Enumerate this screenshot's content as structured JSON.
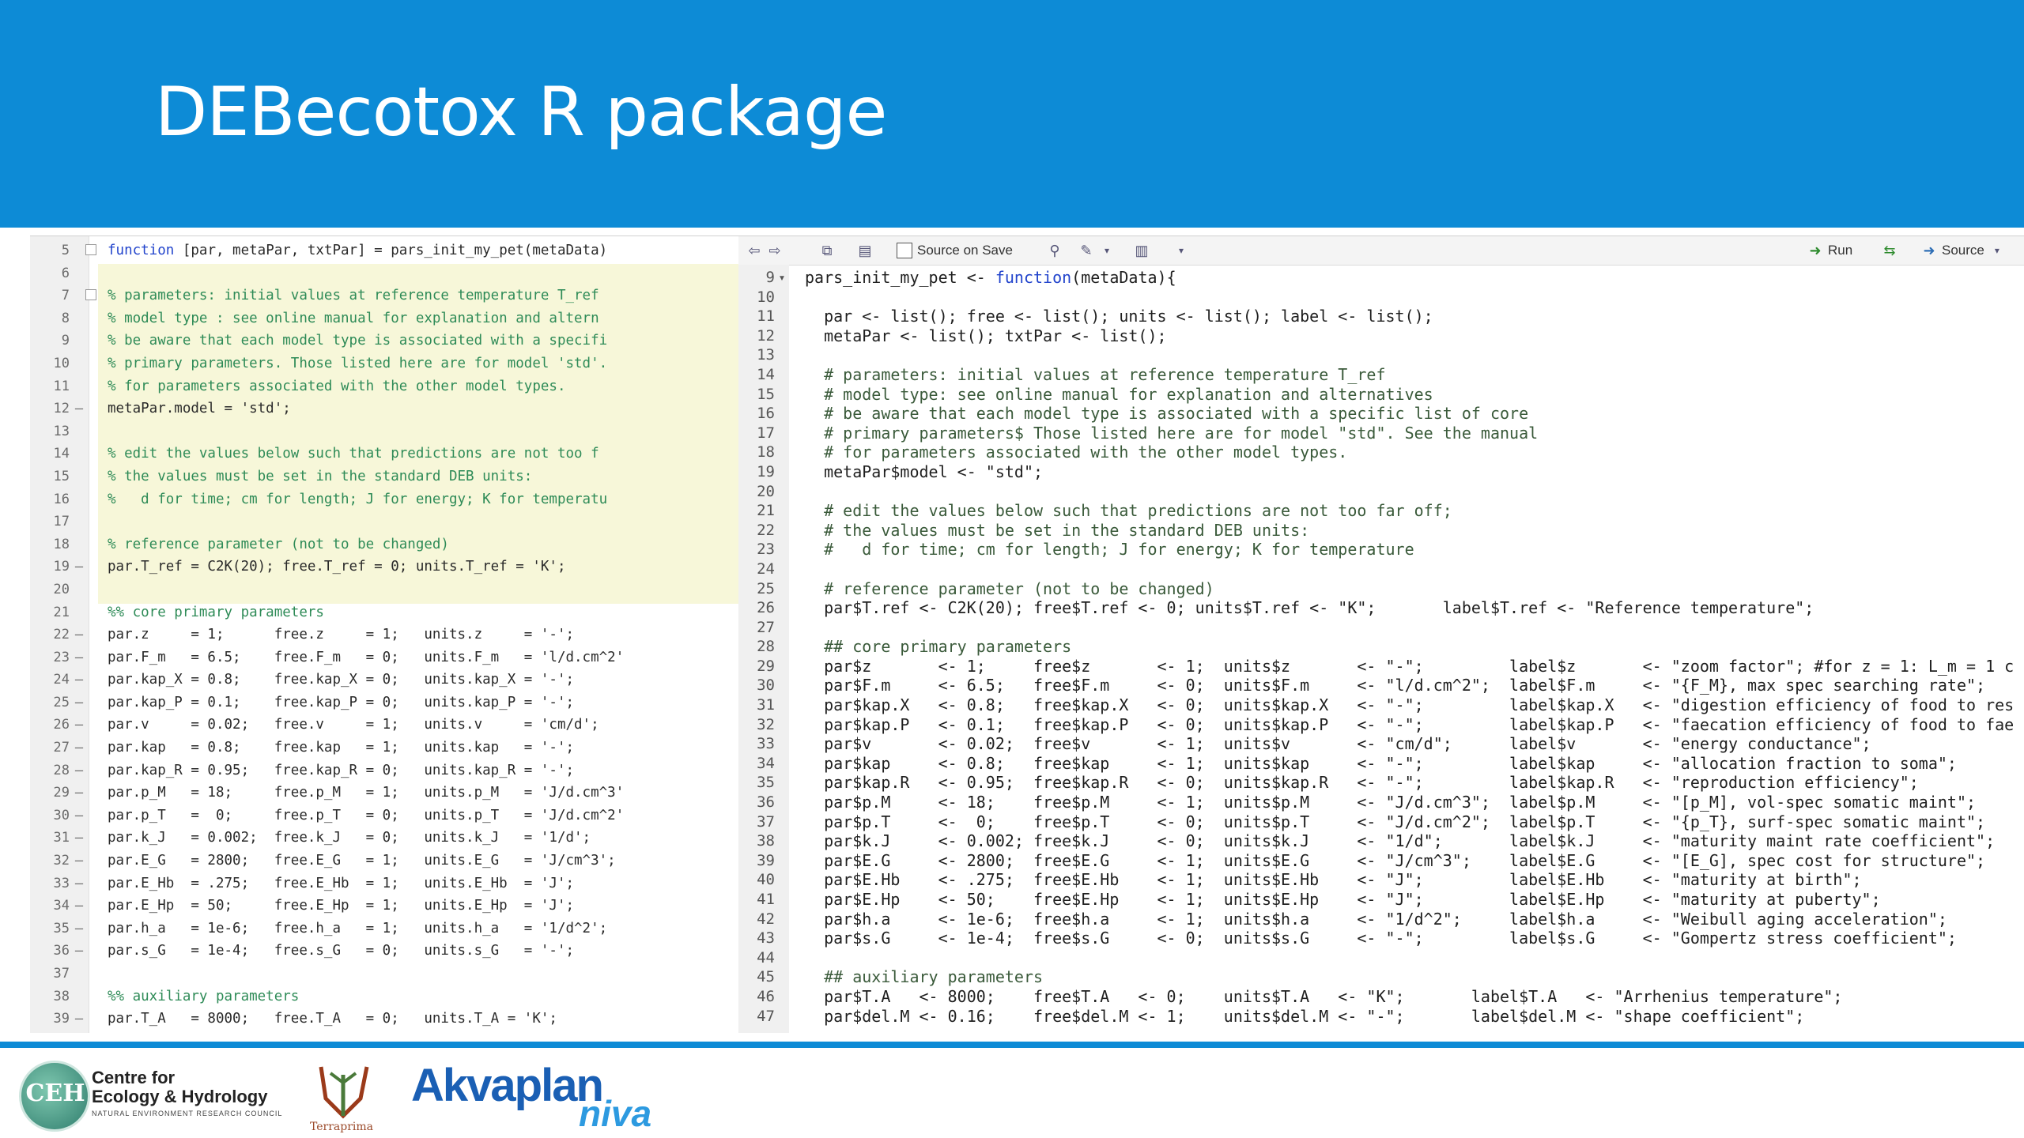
{
  "slide": {
    "title": "DEBecotox R package"
  },
  "toolbar": {
    "source_on_save": "Source on Save",
    "run": "Run",
    "source": "Source"
  },
  "left_editor": {
    "lines": [
      {
        "n": "5",
        "m": "",
        "t": "function [par, metaPar, txtPar] = pars_init_my_pet(metaData)",
        "c": false
      },
      {
        "n": "6",
        "m": "",
        "t": "",
        "c": false
      },
      {
        "n": "7",
        "m": "",
        "t": "% parameters: initial values at reference temperature T_ref",
        "c": true
      },
      {
        "n": "8",
        "m": "",
        "t": "% model type : see online manual for explanation and altern",
        "c": true
      },
      {
        "n": "9",
        "m": "",
        "t": "% be aware that each model type is associated with a specifi",
        "c": true
      },
      {
        "n": "10",
        "m": "",
        "t": "% primary parameters. Those listed here are for model 'std'.",
        "c": true
      },
      {
        "n": "11",
        "m": "",
        "t": "% for parameters associated with the other model types.",
        "c": true
      },
      {
        "n": "12",
        "m": "–",
        "t": "metaPar.model = 'std';",
        "c": false
      },
      {
        "n": "13",
        "m": "",
        "t": "",
        "c": false
      },
      {
        "n": "14",
        "m": "",
        "t": "% edit the values below such that predictions are not too f",
        "c": true
      },
      {
        "n": "15",
        "m": "",
        "t": "% the values must be set in the standard DEB units:",
        "c": true
      },
      {
        "n": "16",
        "m": "",
        "t": "%   d for time; cm for length; J for energy; K for temperatu",
        "c": true
      },
      {
        "n": "17",
        "m": "",
        "t": "",
        "c": false
      },
      {
        "n": "18",
        "m": "",
        "t": "% reference parameter (not to be changed)",
        "c": true
      },
      {
        "n": "19",
        "m": "–",
        "t": "par.T_ref = C2K(20); free.T_ref = 0; units.T_ref = 'K';",
        "c": false
      },
      {
        "n": "20",
        "m": "",
        "t": "",
        "c": false
      },
      {
        "n": "21",
        "m": "",
        "t": "%% core primary parameters",
        "c": true
      },
      {
        "n": "22",
        "m": "–",
        "t": "par.z     = 1;      free.z     = 1;   units.z     = '-';",
        "c": false
      },
      {
        "n": "23",
        "m": "–",
        "t": "par.F_m   = 6.5;    free.F_m   = 0;   units.F_m   = 'l/d.cm^2'",
        "c": false
      },
      {
        "n": "24",
        "m": "–",
        "t": "par.kap_X = 0.8;    free.kap_X = 0;   units.kap_X = '-';",
        "c": false
      },
      {
        "n": "25",
        "m": "–",
        "t": "par.kap_P = 0.1;    free.kap_P = 0;   units.kap_P = '-';",
        "c": false
      },
      {
        "n": "26",
        "m": "–",
        "t": "par.v     = 0.02;   free.v     = 1;   units.v     = 'cm/d';",
        "c": false
      },
      {
        "n": "27",
        "m": "–",
        "t": "par.kap   = 0.8;    free.kap   = 1;   units.kap   = '-';",
        "c": false
      },
      {
        "n": "28",
        "m": "–",
        "t": "par.kap_R = 0.95;   free.kap_R = 0;   units.kap_R = '-';",
        "c": false
      },
      {
        "n": "29",
        "m": "–",
        "t": "par.p_M   = 18;     free.p_M   = 1;   units.p_M   = 'J/d.cm^3'",
        "c": false
      },
      {
        "n": "30",
        "m": "–",
        "t": "par.p_T   =  0;     free.p_T   = 0;   units.p_T   = 'J/d.cm^2'",
        "c": false
      },
      {
        "n": "31",
        "m": "–",
        "t": "par.k_J   = 0.002;  free.k_J   = 0;   units.k_J   = '1/d';",
        "c": false
      },
      {
        "n": "32",
        "m": "–",
        "t": "par.E_G   = 2800;   free.E_G   = 1;   units.E_G   = 'J/cm^3';",
        "c": false
      },
      {
        "n": "33",
        "m": "–",
        "t": "par.E_Hb  = .275;   free.E_Hb  = 1;   units.E_Hb  = 'J';",
        "c": false
      },
      {
        "n": "34",
        "m": "–",
        "t": "par.E_Hp  = 50;     free.E_Hp  = 1;   units.E_Hp  = 'J';",
        "c": false
      },
      {
        "n": "35",
        "m": "–",
        "t": "par.h_a   = 1e-6;   free.h_a   = 1;   units.h_a   = '1/d^2';",
        "c": false
      },
      {
        "n": "36",
        "m": "–",
        "t": "par.s_G   = 1e-4;   free.s_G   = 0;   units.s_G   = '-';",
        "c": false
      },
      {
        "n": "37",
        "m": "",
        "t": "",
        "c": false
      },
      {
        "n": "38",
        "m": "",
        "t": "%% auxiliary parameters",
        "c": true
      },
      {
        "n": "39",
        "m": "–",
        "t": "par.T_A   = 8000;   free.T_A   = 0;   units.T_A = 'K';",
        "c": false
      }
    ]
  },
  "right_editor": {
    "lines": [
      {
        "n": "9",
        "m": "▾",
        "t": "pars_init_my_pet <- function(metaData){",
        "c": false
      },
      {
        "n": "10",
        "m": "",
        "t": "",
        "c": false
      },
      {
        "n": "11",
        "m": "",
        "t": "  par <- list(); free <- list(); units <- list(); label <- list();",
        "c": false
      },
      {
        "n": "12",
        "m": "",
        "t": "  metaPar <- list(); txtPar <- list();",
        "c": false
      },
      {
        "n": "13",
        "m": "",
        "t": "",
        "c": false
      },
      {
        "n": "14",
        "m": "",
        "t": "  # parameters: initial values at reference temperature T_ref",
        "c": true
      },
      {
        "n": "15",
        "m": "",
        "t": "  # model type: see online manual for explanation and alternatives",
        "c": true
      },
      {
        "n": "16",
        "m": "",
        "t": "  # be aware that each model type is associated with a specific list of core",
        "c": true
      },
      {
        "n": "17",
        "m": "",
        "t": "  # primary parameters$ Those listed here are for model \"std\". See the manual",
        "c": true
      },
      {
        "n": "18",
        "m": "",
        "t": "  # for parameters associated with the other model types.",
        "c": true
      },
      {
        "n": "19",
        "m": "",
        "t": "  metaPar$model <- \"std\";",
        "c": false
      },
      {
        "n": "20",
        "m": "",
        "t": "",
        "c": false
      },
      {
        "n": "21",
        "m": "",
        "t": "  # edit the values below such that predictions are not too far off;",
        "c": true
      },
      {
        "n": "22",
        "m": "",
        "t": "  # the values must be set in the standard DEB units:",
        "c": true
      },
      {
        "n": "23",
        "m": "",
        "t": "  #   d for time; cm for length; J for energy; K for temperature",
        "c": true
      },
      {
        "n": "24",
        "m": "",
        "t": "",
        "c": false
      },
      {
        "n": "25",
        "m": "",
        "t": "  # reference parameter (not to be changed)",
        "c": true
      },
      {
        "n": "26",
        "m": "",
        "t": "  par$T.ref <- C2K(20); free$T.ref <- 0; units$T.ref <- \"K\";       label$T.ref <- \"Reference temperature\";",
        "c": false
      },
      {
        "n": "27",
        "m": "",
        "t": "",
        "c": false
      },
      {
        "n": "28",
        "m": "",
        "t": "  ## core primary parameters",
        "c": true
      },
      {
        "n": "29",
        "m": "",
        "t": "  par$z       <- 1;     free$z       <- 1;  units$z       <- \"-\";         label$z       <- \"zoom factor\"; #for z = 1: L_m = 1 c",
        "c": false
      },
      {
        "n": "30",
        "m": "",
        "t": "  par$F.m     <- 6.5;   free$F.m     <- 0;  units$F.m     <- \"l/d.cm^2\";  label$F.m     <- \"{F_M}, max spec searching rate\";",
        "c": false
      },
      {
        "n": "31",
        "m": "",
        "t": "  par$kap.X   <- 0.8;   free$kap.X   <- 0;  units$kap.X   <- \"-\";         label$kap.X   <- \"digestion efficiency of food to res",
        "c": false
      },
      {
        "n": "32",
        "m": "",
        "t": "  par$kap.P   <- 0.1;   free$kap.P   <- 0;  units$kap.P   <- \"-\";         label$kap.P   <- \"faecation efficiency of food to fae",
        "c": false
      },
      {
        "n": "33",
        "m": "",
        "t": "  par$v       <- 0.02;  free$v       <- 1;  units$v       <- \"cm/d\";      label$v       <- \"energy conductance\";",
        "c": false
      },
      {
        "n": "34",
        "m": "",
        "t": "  par$kap     <- 0.8;   free$kap     <- 1;  units$kap     <- \"-\";         label$kap     <- \"allocation fraction to soma\";",
        "c": false
      },
      {
        "n": "35",
        "m": "",
        "t": "  par$kap.R   <- 0.95;  free$kap.R   <- 0;  units$kap.R   <- \"-\";         label$kap.R   <- \"reproduction efficiency\";",
        "c": false
      },
      {
        "n": "36",
        "m": "",
        "t": "  par$p.M     <- 18;    free$p.M     <- 1;  units$p.M     <- \"J/d.cm^3\";  label$p.M     <- \"[p_M], vol-spec somatic maint\";",
        "c": false
      },
      {
        "n": "37",
        "m": "",
        "t": "  par$p.T     <-  0;    free$p.T     <- 0;  units$p.T     <- \"J/d.cm^2\";  label$p.T     <- \"{p_T}, surf-spec somatic maint\";",
        "c": false
      },
      {
        "n": "38",
        "m": "",
        "t": "  par$k.J     <- 0.002; free$k.J     <- 0;  units$k.J     <- \"1/d\";       label$k.J     <- \"maturity maint rate coefficient\";",
        "c": false
      },
      {
        "n": "39",
        "m": "",
        "t": "  par$E.G     <- 2800;  free$E.G     <- 1;  units$E.G     <- \"J/cm^3\";    label$E.G     <- \"[E_G], spec cost for structure\";",
        "c": false
      },
      {
        "n": "40",
        "m": "",
        "t": "  par$E.Hb    <- .275;  free$E.Hb    <- 1;  units$E.Hb    <- \"J\";         label$E.Hb    <- \"maturity at birth\";",
        "c": false
      },
      {
        "n": "41",
        "m": "",
        "t": "  par$E.Hp    <- 50;    free$E.Hp    <- 1;  units$E.Hp    <- \"J\";         label$E.Hp    <- \"maturity at puberty\";",
        "c": false
      },
      {
        "n": "42",
        "m": "",
        "t": "  par$h.a     <- 1e-6;  free$h.a     <- 1;  units$h.a     <- \"1/d^2\";     label$h.a     <- \"Weibull aging acceleration\";",
        "c": false
      },
      {
        "n": "43",
        "m": "",
        "t": "  par$s.G     <- 1e-4;  free$s.G     <- 0;  units$s.G     <- \"-\";         label$s.G     <- \"Gompertz stress coefficient\";",
        "c": false
      },
      {
        "n": "44",
        "m": "",
        "t": "",
        "c": false
      },
      {
        "n": "45",
        "m": "",
        "t": "  ## auxiliary parameters",
        "c": true
      },
      {
        "n": "46",
        "m": "",
        "t": "  par$T.A   <- 8000;    free$T.A   <- 0;    units$T.A   <- \"K\";       label$T.A   <- \"Arrhenius temperature\";",
        "c": false
      },
      {
        "n": "47",
        "m": "",
        "t": "  par$del.M <- 0.16;    free$del.M <- 1;    units$del.M <- \"-\";       label$del.M <- \"shape coefficient\";",
        "c": false
      }
    ]
  },
  "footer": {
    "ceh_mark": "CEH",
    "ceh_line1": "Centre for",
    "ceh_line2": "Ecology & Hydrology",
    "ceh_line3": "NATURAL ENVIRONMENT RESEARCH COUNCIL",
    "terraprima": "Terraprima",
    "akvaplan": "Akvaplan",
    "niva": "niva"
  },
  "colors": {
    "banner": "#0d8bd6",
    "comment_left": "#2e8b57",
    "highlight": "#f7f7d9"
  }
}
